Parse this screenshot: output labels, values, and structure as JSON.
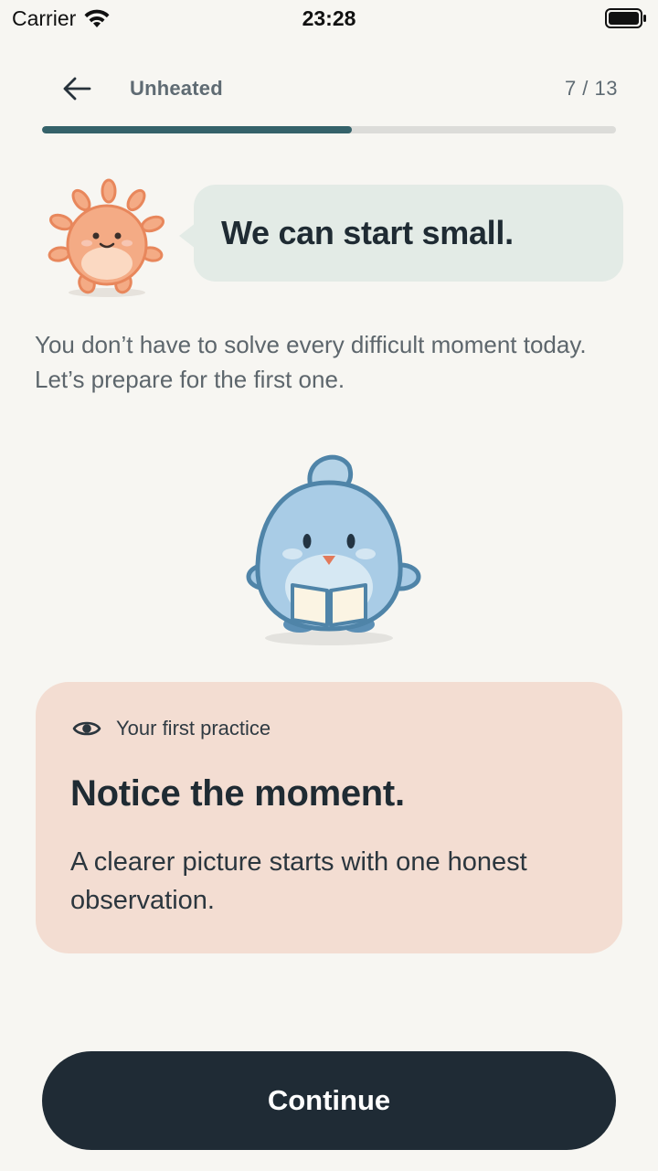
{
  "status_bar": {
    "carrier": "Carrier",
    "time": "23:28",
    "icons": [
      "wifi-icon",
      "battery-icon"
    ]
  },
  "header": {
    "back_icon": "arrow-left-icon",
    "title": "Unheated",
    "step": "7 / 13",
    "progress": 0.54
  },
  "speech": {
    "text": "We can start small."
  },
  "intro": {
    "text": "You don’t have to solve every difficult moment today. Let’s prepare for the first one."
  },
  "card": {
    "icon": "eye-icon",
    "eyebrow": "Your first practice",
    "title": "Notice the moment.",
    "body": "A clearer picture starts with one honest observation."
  },
  "actions": {
    "continue_label": "Continue"
  },
  "colors": {
    "background": "#f7f6f2",
    "progress_fill": "#35626a",
    "bubble": "#e3ebe6",
    "card": "#f3ddd2",
    "button": "#1f2b35"
  }
}
